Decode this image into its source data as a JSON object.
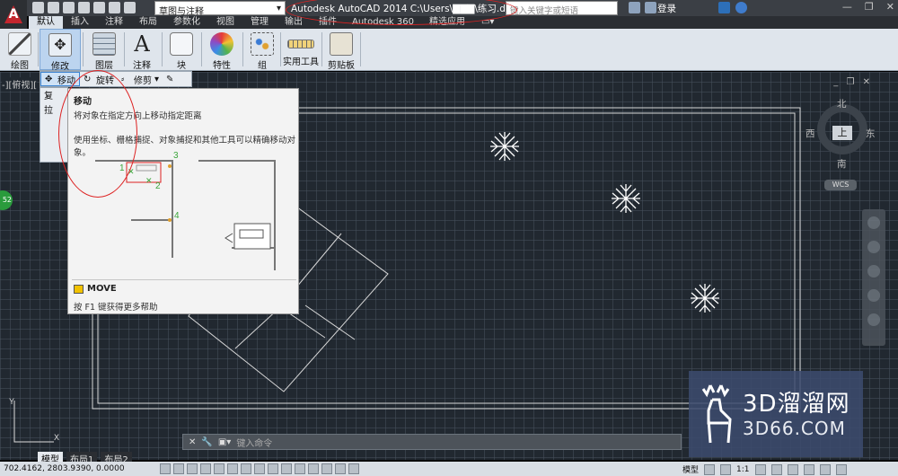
{
  "titlebar": {
    "app_letter": "A",
    "workspace": "草图与注释",
    "title": "Autodesk AutoCAD 2014    C:\\Users\\▇▇▇\\练习.dwg",
    "search_placeholder": "键入关键字或短语",
    "login": "登录",
    "window_controls": [
      "—",
      "❐",
      "✕"
    ]
  },
  "ribbon_tabs": [
    "默认",
    "插入",
    "注释",
    "布局",
    "参数化",
    "视图",
    "管理",
    "输出",
    "插件",
    "Autodesk 360",
    "精选应用",
    "▭▾"
  ],
  "ribbon_panels": [
    "绘图",
    "修改",
    "图层",
    "注释",
    "块",
    "特性",
    "组",
    "实用工具",
    "剪贴板"
  ],
  "modify_toolbar": {
    "items": [
      "移动",
      "旋转",
      "修剪"
    ],
    "subitems": [
      "复",
      "拉",
      "",
      ""
    ]
  },
  "viewport": {
    "label": "-][俯视][",
    "controls": "_ ❐ ✕"
  },
  "tooltip": {
    "title": "移动",
    "description": "将对象在指定方向上移动指定距离",
    "details": "使用坐标、栅格捕捉、对象捕捉和其他工具可以精确移动对象。",
    "step_labels": [
      "1",
      "2",
      "3",
      "4"
    ],
    "command": "MOVE",
    "help": "按 F1 键获得更多帮助"
  },
  "compass": {
    "north": "北",
    "south": "南",
    "west": "西",
    "east": "东",
    "top": "上",
    "wcs": "WCS"
  },
  "command_line": {
    "placeholder": "键入命令",
    "buttons": [
      "✕",
      "🔧",
      "▣▾"
    ]
  },
  "layout_tabs": [
    "模型",
    "布局1",
    "布局2"
  ],
  "status_bar": {
    "coordinates": "702.4162,  2803.9390, 0.0000",
    "model_label": "模型",
    "scale": "1:1"
  },
  "watermark": {
    "brand": "3D溜溜网",
    "url": "3D66.COM"
  },
  "green_badge": "52"
}
